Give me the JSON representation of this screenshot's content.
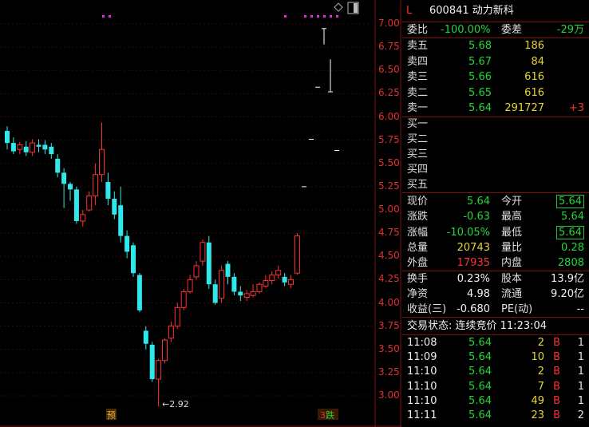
{
  "stock": {
    "code_name": "600841 动力新科",
    "l_badge": "L"
  },
  "ratio": {
    "wb_label": "委比",
    "wb_value": "-100.00%",
    "wc_label": "委差",
    "wc_value": "-29万"
  },
  "asks": [
    {
      "label": "卖五",
      "price": "5.68",
      "volume": "186",
      "extra": ""
    },
    {
      "label": "卖四",
      "price": "5.67",
      "volume": "84",
      "extra": ""
    },
    {
      "label": "卖三",
      "price": "5.66",
      "volume": "616",
      "extra": ""
    },
    {
      "label": "卖二",
      "price": "5.65",
      "volume": "616",
      "extra": ""
    },
    {
      "label": "卖一",
      "price": "5.64",
      "volume": "291727",
      "extra": "+3"
    }
  ],
  "bids": [
    {
      "label": "买一"
    },
    {
      "label": "买二"
    },
    {
      "label": "买三"
    },
    {
      "label": "买四"
    },
    {
      "label": "买五"
    }
  ],
  "quote": [
    {
      "l1": "现价",
      "v1": "5.64",
      "l2": "今开",
      "v2": "5.64"
    },
    {
      "l1": "涨跌",
      "v1": "-0.63",
      "l2": "最高",
      "v2": "5.64"
    },
    {
      "l1": "涨幅",
      "v1": "-10.05%",
      "l2": "最低",
      "v2": "5.64"
    },
    {
      "l1": "总量",
      "v1": "20743",
      "l2": "量比",
      "v2": "0.28"
    },
    {
      "l1": "外盘",
      "v1": "17935",
      "l2": "内盘",
      "v2": "2808"
    }
  ],
  "fundamentals": [
    {
      "l1": "换手",
      "v1": "0.23%",
      "l2": "股本",
      "v2": "13.9亿"
    },
    {
      "l1": "净资",
      "v1": "4.98",
      "l2": "流通",
      "v2": "9.20亿"
    },
    {
      "l1": "收益(三)",
      "v1": "-0.680",
      "l2": "PE(动)",
      "v2": "--"
    }
  ],
  "trade_status": "交易状态: 连续竞价 11:23:04",
  "ticks": [
    {
      "time": "11:08",
      "price": "5.64",
      "vol": "2",
      "side": "B",
      "n": "1"
    },
    {
      "time": "11:09",
      "price": "5.64",
      "vol": "10",
      "side": "B",
      "n": "1"
    },
    {
      "time": "11:10",
      "price": "5.64",
      "vol": "2",
      "side": "B",
      "n": "1"
    },
    {
      "time": "11:10",
      "price": "5.64",
      "vol": "7",
      "side": "B",
      "n": "1"
    },
    {
      "time": "11:10",
      "price": "5.64",
      "vol": "49",
      "side": "B",
      "n": "1"
    },
    {
      "time": "11:11",
      "price": "5.64",
      "vol": "23",
      "side": "B",
      "n": "2"
    }
  ],
  "chart_labels": {
    "yu": "预",
    "die": "跌",
    "low_marker": "←2.92"
  },
  "chart_data": {
    "type": "candlestick",
    "ylim": [
      2.9,
      7.1
    ],
    "y_ticks": [
      "3.00",
      "3.25",
      "3.50",
      "3.75",
      "4.00",
      "4.25",
      "4.50",
      "4.75",
      "5.00",
      "5.25",
      "5.50",
      "5.75",
      "6.00",
      "6.25",
      "6.50",
      "6.75",
      "7.00"
    ],
    "colors": {
      "up": "#ff3030",
      "down": "#30e8ea"
    },
    "candles": [
      {
        "o": 5.85,
        "c": 5.72,
        "h": 5.9,
        "l": 5.65
      },
      {
        "o": 5.72,
        "c": 5.63,
        "h": 5.78,
        "l": 5.6
      },
      {
        "o": 5.65,
        "c": 5.7,
        "h": 5.73,
        "l": 5.6
      },
      {
        "o": 5.68,
        "c": 5.62,
        "h": 5.74,
        "l": 5.58
      },
      {
        "o": 5.62,
        "c": 5.72,
        "h": 5.76,
        "l": 5.58
      },
      {
        "o": 5.7,
        "c": 5.68,
        "h": 5.76,
        "l": 5.62
      },
      {
        "o": 5.7,
        "c": 5.65,
        "h": 5.75,
        "l": 5.6
      },
      {
        "o": 5.68,
        "c": 5.6,
        "h": 5.72,
        "l": 5.55
      },
      {
        "o": 5.55,
        "c": 5.4,
        "h": 5.6,
        "l": 5.35
      },
      {
        "o": 5.4,
        "c": 5.28,
        "h": 5.45,
        "l": 5.02
      },
      {
        "o": 5.28,
        "c": 5.22,
        "h": 5.3,
        "l": 5.1
      },
      {
        "o": 5.22,
        "c": 4.88,
        "h": 5.25,
        "l": 4.85
      },
      {
        "o": 4.88,
        "c": 4.95,
        "h": 5.0,
        "l": 4.82
      },
      {
        "o": 5.0,
        "c": 5.15,
        "h": 5.2,
        "l": 4.98
      },
      {
        "o": 5.15,
        "c": 5.38,
        "h": 5.5,
        "l": 5.05
      },
      {
        "o": 5.38,
        "c": 5.65,
        "h": 5.94,
        "l": 5.3
      },
      {
        "o": 5.3,
        "c": 5.12,
        "h": 5.4,
        "l": 5.05
      },
      {
        "o": 5.12,
        "c": 4.95,
        "h": 5.2,
        "l": 4.9
      },
      {
        "o": 5.05,
        "c": 4.72,
        "h": 5.25,
        "l": 4.65
      },
      {
        "o": 4.72,
        "c": 4.55,
        "h": 4.78,
        "l": 4.48
      },
      {
        "o": 4.62,
        "c": 4.32,
        "h": 4.65,
        "l": 4.28
      },
      {
        "o": 4.3,
        "c": 3.92,
        "h": 4.32,
        "l": 3.9
      },
      {
        "o": 3.7,
        "c": 3.56,
        "h": 3.75,
        "l": 3.5
      },
      {
        "o": 3.55,
        "c": 3.18,
        "h": 3.58,
        "l": 3.15
      },
      {
        "o": 3.18,
        "c": 3.38,
        "h": 3.4,
        "l": 2.92
      },
      {
        "o": 3.38,
        "c": 3.6,
        "h": 3.62,
        "l": 3.35
      },
      {
        "o": 3.62,
        "c": 3.75,
        "h": 3.8,
        "l": 3.58
      },
      {
        "o": 3.75,
        "c": 3.95,
        "h": 4.0,
        "l": 3.72
      },
      {
        "o": 3.95,
        "c": 4.12,
        "h": 4.15,
        "l": 3.92
      },
      {
        "o": 4.12,
        "c": 4.25,
        "h": 4.3,
        "l": 4.1
      },
      {
        "o": 4.28,
        "c": 4.4,
        "h": 4.45,
        "l": 4.25
      },
      {
        "o": 4.45,
        "c": 4.65,
        "h": 4.68,
        "l": 4.4
      },
      {
        "o": 4.65,
        "c": 4.2,
        "h": 4.72,
        "l": 4.15
      },
      {
        "o": 4.2,
        "c": 4.0,
        "h": 4.25,
        "l": 3.98
      },
      {
        "o": 4.05,
        "c": 4.35,
        "h": 4.4,
        "l": 4.0
      },
      {
        "o": 4.42,
        "c": 4.28,
        "h": 4.45,
        "l": 4.2
      },
      {
        "o": 4.28,
        "c": 4.12,
        "h": 4.32,
        "l": 4.08
      },
      {
        "o": 4.12,
        "c": 4.08,
        "h": 4.18,
        "l": 4.02
      },
      {
        "o": 4.06,
        "c": 4.1,
        "h": 4.14,
        "l": 4.02
      },
      {
        "o": 4.08,
        "c": 4.12,
        "h": 4.2,
        "l": 4.06
      },
      {
        "o": 4.12,
        "c": 4.2,
        "h": 4.22,
        "l": 4.1
      },
      {
        "o": 4.18,
        "c": 4.24,
        "h": 4.3,
        "l": 4.16
      },
      {
        "o": 4.24,
        "c": 4.3,
        "h": 4.34,
        "l": 4.2
      },
      {
        "o": 4.3,
        "c": 4.35,
        "h": 4.4,
        "l": 4.26
      },
      {
        "o": 4.28,
        "c": 4.22,
        "h": 4.32,
        "l": 4.18
      },
      {
        "o": 4.2,
        "c": 4.25,
        "h": 4.3,
        "l": 4.16
      },
      {
        "o": 4.32,
        "c": 4.72,
        "h": 4.75,
        "l": 4.3
      },
      {
        "o": 5.25,
        "c": 5.25,
        "h": 5.25,
        "l": 5.25
      },
      {
        "o": 5.76,
        "c": 5.76,
        "h": 5.76,
        "l": 5.76
      },
      {
        "o": 6.32,
        "c": 6.32,
        "h": 6.32,
        "l": 6.32
      },
      {
        "o": 6.95,
        "c": 6.95,
        "h": 6.95,
        "l": 6.78
      },
      {
        "o": 6.27,
        "c": 6.27,
        "h": 6.62,
        "l": 6.27
      },
      {
        "o": 5.64,
        "c": 5.64,
        "h": 5.64,
        "l": 5.64
      }
    ]
  }
}
